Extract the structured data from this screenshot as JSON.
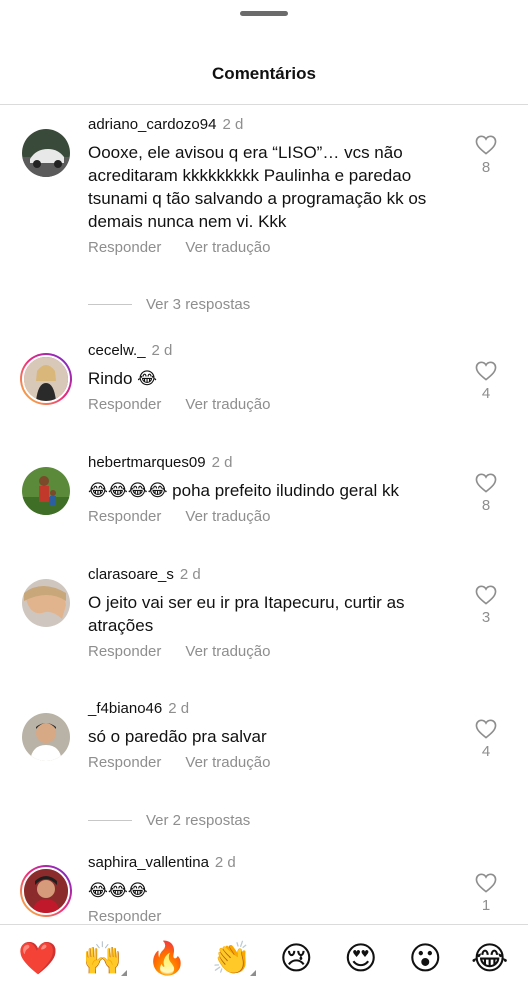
{
  "header": {
    "title": "Comentários"
  },
  "actions": {
    "reply": "Responder",
    "translate": "Ver tradução"
  },
  "comments": [
    {
      "username": "adriano_cardozo94",
      "time": "2 d",
      "text": "Oooxe, ele avisou q era “LISO”… vcs não acreditaram kkkkkkkkk Paulinha e paredao tsunami q tão salvando a programação kk os demais nunca nem vi. Kkk",
      "likes": "8",
      "replies": "Ver 3 respostas",
      "translate": true
    },
    {
      "username": "cecelw._",
      "time": "2 d",
      "text": "Rindo 😂",
      "likes": "4",
      "translate": true
    },
    {
      "username": "hebertmarques09",
      "time": "2 d",
      "text": "😂😂😂😂 poha prefeito iludindo geral kk",
      "likes": "8",
      "translate": true
    },
    {
      "username": "clarasoare_s",
      "time": "2 d",
      "text": "O jeito vai ser eu ir pra Itapecuru, curtir as atrações",
      "likes": "3",
      "translate": true
    },
    {
      "username": "_f4biano46",
      "time": "2 d",
      "text": "só o paredão pra salvar",
      "likes": "4",
      "replies": "Ver 2 respostas",
      "translate": true
    },
    {
      "username": "saphira_vallentina",
      "time": "2 d",
      "text": "😂😂😂",
      "likes": "1",
      "translate": false
    }
  ],
  "emoji_bar": [
    "❤️",
    "🙌",
    "🔥",
    "👏",
    "😢",
    "😍",
    "😮",
    "😂"
  ]
}
